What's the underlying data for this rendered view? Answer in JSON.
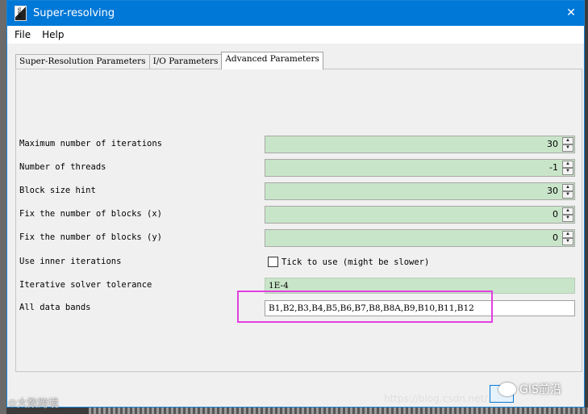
{
  "window": {
    "title": "Super-resolving",
    "close_glyph": "✕"
  },
  "menu": {
    "items": [
      "File",
      "Help"
    ]
  },
  "tabs": [
    {
      "label": "Super-Resolution Parameters",
      "active": false
    },
    {
      "label": "I/O Parameters",
      "active": false
    },
    {
      "label": "Advanced Parameters",
      "active": true
    }
  ],
  "params": {
    "max_iterations": {
      "label": "Maximum number of iterations",
      "value": "30"
    },
    "threads": {
      "label": "Number of threads",
      "value": "-1"
    },
    "block_size": {
      "label": "Block size hint",
      "value": "30"
    },
    "blocks_x": {
      "label": "Fix the number of blocks (x)",
      "value": "0"
    },
    "blocks_y": {
      "label": "Fix the number of blocks (y)",
      "value": "0"
    },
    "inner_iterations": {
      "label": "Use inner iterations",
      "checkbox_label": "Tick to use (might be slower)",
      "checked": false
    },
    "tolerance": {
      "label": "Iterative solver tolerance",
      "value": "1E-4"
    },
    "data_bands": {
      "label": "All data bands",
      "value": "B1,B2,B3,B4,B5,B6,B7,B8,B8A,B9,B10,B11,B12"
    }
  },
  "spin_arrows": {
    "up": "▲",
    "down": "▼"
  },
  "watermarks": {
    "left": "⊙大数跨境",
    "gis": "GIS前沿",
    "url": "https://blog.csdn.net/..."
  },
  "colors": {
    "titlebar": "#0078d7",
    "field_green": "#c9e5c9",
    "highlight": "#e040e0"
  }
}
